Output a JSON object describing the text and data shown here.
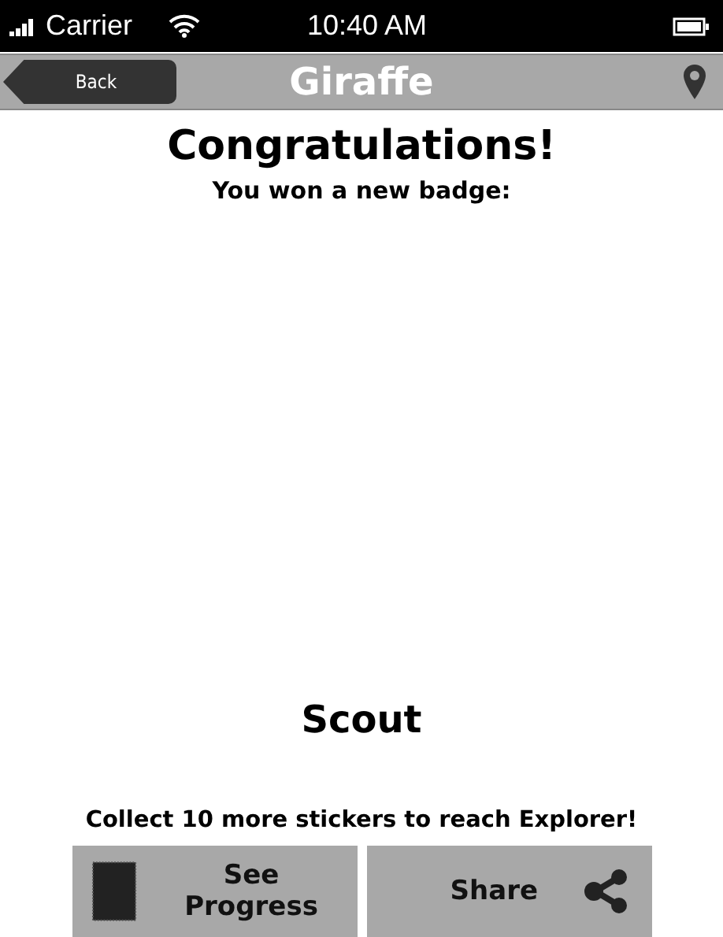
{
  "status_bar": {
    "carrier": "Carrier",
    "time": "10:40 AM"
  },
  "nav_bar": {
    "back": "Back",
    "title": "Giraffe"
  },
  "heading": "Congratulations!",
  "subtitle": "You won a new badge:",
  "badge_name": "Scout",
  "message": "Collect 10 more stickers to reach Explorer!",
  "buttons": [
    {
      "kind": "progress",
      "label": "See Progress"
    },
    {
      "kind": "share",
      "label": "Share"
    }
  ]
}
